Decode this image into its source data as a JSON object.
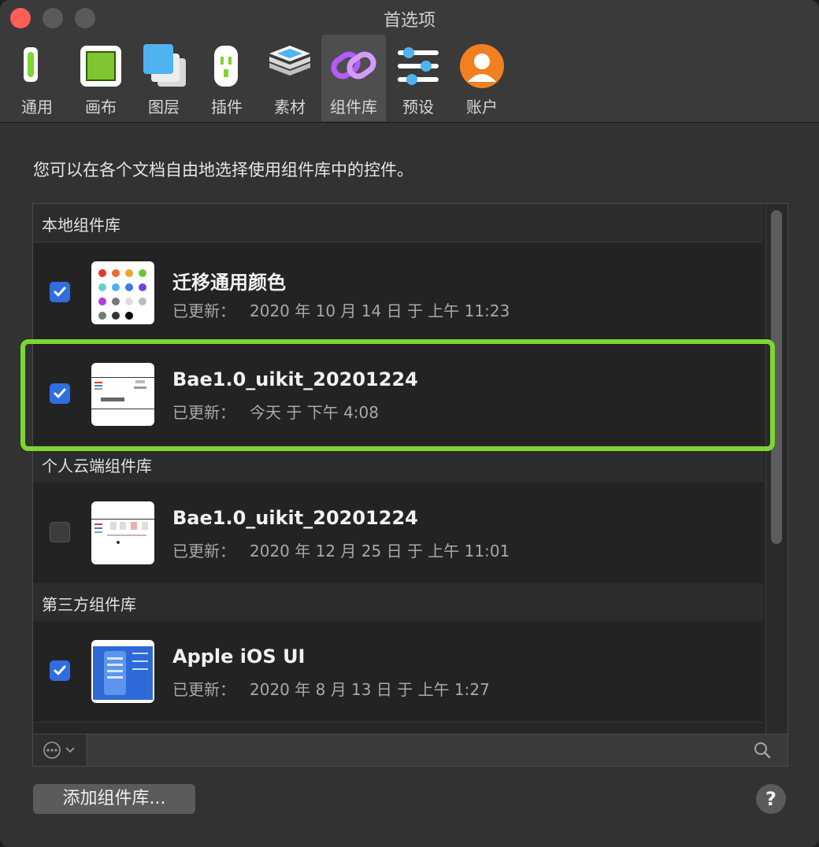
{
  "window": {
    "title": "首选项"
  },
  "toolbar": {
    "tabs": [
      {
        "label": "通用",
        "icon": "general-icon"
      },
      {
        "label": "画布",
        "icon": "canvas-icon"
      },
      {
        "label": "图层",
        "icon": "layers-icon"
      },
      {
        "label": "插件",
        "icon": "plugin-icon"
      },
      {
        "label": "素材",
        "icon": "assets-icon"
      },
      {
        "label": "组件库",
        "icon": "libraries-icon",
        "active": true
      },
      {
        "label": "预设",
        "icon": "presets-icon"
      },
      {
        "label": "账户",
        "icon": "account-icon"
      }
    ]
  },
  "intro": "您可以在各个文档自由地选择使用组件库中的控件。",
  "sections": [
    {
      "title": "本地组件库"
    },
    {
      "title": "个人云端组件库"
    },
    {
      "title": "第三方组件库"
    }
  ],
  "libraries": [
    {
      "name": "迁移通用颜色",
      "updated_label": "已更新：",
      "updated": "2020 年 10 月 14 日 于 上午 11:23",
      "checked": true
    },
    {
      "name": "Bae1.0_uikit_20201224",
      "updated_label": "已更新：",
      "updated": "今天 于 下午 4:08",
      "checked": true,
      "highlighted": true
    },
    {
      "name": "Bae1.0_uikit_20201224",
      "updated_label": "已更新：",
      "updated": "2020 年 12 月 25 日 于 上午 11:01",
      "checked": false
    },
    {
      "name": "Apple iOS UI",
      "updated_label": "已更新：",
      "updated": "2020 年 8 月 13 日 于 上午 1:27",
      "checked": true
    }
  ],
  "search": {
    "placeholder": ""
  },
  "footer": {
    "add_button": "添加组件库...",
    "help_button": "?"
  },
  "colors": {
    "accent_check": "#2f6ee0",
    "highlight": "#7ed631"
  }
}
